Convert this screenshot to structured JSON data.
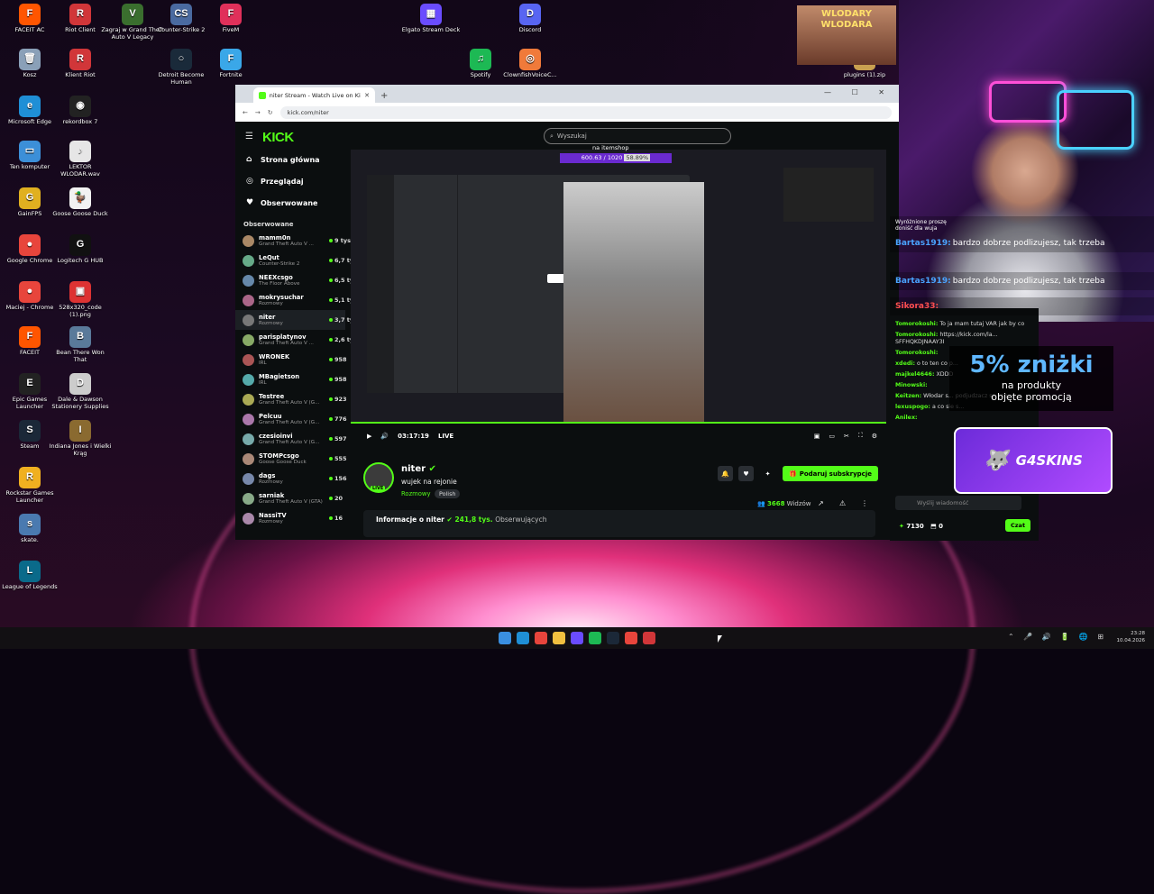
{
  "desktop_icons": [
    {
      "label": "FACEIT AC",
      "color": "#ff5500",
      "glyph": "F"
    },
    {
      "label": "Riot Client",
      "color": "#d13639",
      "glyph": "R"
    },
    {
      "label": "Zagraj w Grand Theft Auto V Legacy",
      "color": "#3a6e2e",
      "glyph": "V"
    },
    {
      "label": "Counter-Strike 2",
      "color": "#4a6aa0",
      "glyph": "CS"
    },
    {
      "label": "FiveM",
      "color": "#e0305a",
      "glyph": "F"
    },
    {
      "label": "Elgato Stream Deck",
      "color": "#6a4cff",
      "glyph": "▦"
    },
    {
      "label": "Discord",
      "color": "#5865f2",
      "glyph": "D"
    },
    {
      "label": "Kosz",
      "color": "#8aa0b8",
      "glyph": "🗑"
    },
    {
      "label": "Klient Riot",
      "color": "#d13639",
      "glyph": "R"
    },
    {
      "label": "Detroit Become Human",
      "color": "#1a2a3a",
      "glyph": "○"
    },
    {
      "label": "Fortnite",
      "color": "#3aa7e8",
      "glyph": "F"
    },
    {
      "label": "Spotify",
      "color": "#1db954",
      "glyph": "♫"
    },
    {
      "label": "ClownfishVoiceC...",
      "color": "#f07a3a",
      "glyph": "◎"
    },
    {
      "label": "plugins (1).zip",
      "color": "#c9a050",
      "glyph": "Z"
    },
    {
      "label": "Microsoft Edge",
      "color": "#1f8fd6",
      "glyph": "e"
    },
    {
      "label": "rekordbox 7",
      "color": "#222",
      "glyph": "◉"
    },
    {
      "label": "Ten komputer",
      "color": "#3c8fd8",
      "glyph": "▭"
    },
    {
      "label": "LEKTOR WLODAR.wav",
      "color": "#e6e6e6",
      "glyph": "♪"
    },
    {
      "label": "GainFPS",
      "color": "#e0b020",
      "glyph": "G"
    },
    {
      "label": "Goose Goose Duck",
      "color": "#f2f2f2",
      "glyph": "🦆"
    },
    {
      "label": "Google Chrome",
      "color": "#e8453c",
      "glyph": "●"
    },
    {
      "label": "Logitech G HUB",
      "color": "#111",
      "glyph": "G"
    },
    {
      "label": "Maciej - Chrome",
      "color": "#e8453c",
      "glyph": "●"
    },
    {
      "label": "528x320_code (1).png",
      "color": "#d33",
      "glyph": "▣"
    },
    {
      "label": "FACEIT",
      "color": "#ff5500",
      "glyph": "F"
    },
    {
      "label": "Bean There Won That",
      "color": "#5a7a9a",
      "glyph": "B"
    },
    {
      "label": "Epic Games Launcher",
      "color": "#222",
      "glyph": "E"
    },
    {
      "label": "Dale & Dawson Stationery Supplies",
      "color": "#ccc",
      "glyph": "D"
    },
    {
      "label": "Steam",
      "color": "#1b2838",
      "glyph": "S"
    },
    {
      "label": "Indiana Jones i Wielki Krąg",
      "color": "#8a6a30",
      "glyph": "I"
    },
    {
      "label": "Rockstar Games Launcher",
      "color": "#f0b020",
      "glyph": "R"
    },
    {
      "label": "skate.",
      "color": "#4a7ab0",
      "glyph": "s"
    },
    {
      "label": "League of Legends",
      "color": "#0a6a8a",
      "glyph": "L"
    }
  ],
  "browser": {
    "tab_title": "niter Stream - Watch Live on Kick",
    "url": "kick.com/niter"
  },
  "kick": {
    "logo": "KICK",
    "search_placeholder": "Wyszukaj",
    "nav": [
      "Strona główna",
      "Przeglądaj",
      "Obserwowane"
    ],
    "followed_header": "Obserwowane",
    "channels": [
      {
        "name": "mamm0n",
        "game": "Grand Theft Auto V ...",
        "viewers": "9 tys.",
        "color": "#a86"
      },
      {
        "name": "LeQut",
        "game": "Counter-Strike 2",
        "viewers": "6,7 tys.",
        "color": "#6a8"
      },
      {
        "name": "NEEXcsgo",
        "game": "The Floor Above",
        "viewers": "6,5 tys.",
        "color": "#68a"
      },
      {
        "name": "mokrysuchar",
        "game": "Rozmowy",
        "viewers": "5,1 tys.",
        "color": "#a68"
      },
      {
        "name": "niter",
        "game": "Rozmowy",
        "viewers": "3,7 tys.",
        "color": "#777"
      },
      {
        "name": "parisplatynov",
        "game": "Grand Theft Auto V ...",
        "viewers": "2,6 tys.",
        "color": "#8a6"
      },
      {
        "name": "WRONEK",
        "game": "IRL",
        "viewers": "958",
        "color": "#a55"
      },
      {
        "name": "MBagietson",
        "game": "IRL",
        "viewers": "958",
        "color": "#5aa"
      },
      {
        "name": "Testree",
        "game": "Grand Theft Auto V (G...",
        "viewers": "923",
        "color": "#aa5"
      },
      {
        "name": "Pelcuu",
        "game": "Grand Theft Auto V (G...",
        "viewers": "776",
        "color": "#a7a"
      },
      {
        "name": "czesioinvi",
        "game": "Grand Theft Auto V (G...",
        "viewers": "597",
        "color": "#7aa"
      },
      {
        "name": "STOMPcsgo",
        "game": "Goose Goose Duck",
        "viewers": "555",
        "color": "#a87"
      },
      {
        "name": "dags",
        "game": "Rozmowy",
        "viewers": "156",
        "color": "#78a"
      },
      {
        "name": "sarniak",
        "game": "Grand Theft Auto V (GTA)",
        "viewers": "20",
        "color": "#8a8"
      },
      {
        "name": "NassiTV",
        "game": "Rozmowy",
        "viewers": "16",
        "color": "#a8a"
      }
    ],
    "player": {
      "time": "03:17:19",
      "live": "LIVE",
      "goal_label": "na itemshop",
      "goal_value": "600.63 / 1020",
      "goal_percent": "58.89%",
      "progress_fraction": 1.0
    },
    "channel": {
      "name": "niter",
      "title": "wujek na rejonie",
      "category": "Rozmowy",
      "tag": "Polish",
      "subscribe": "Podaruj subskrypcje",
      "viewers_count": "3668",
      "viewers_label": "Widzów",
      "live_badge": "LIVE"
    },
    "about": {
      "label": "Informacje o niter",
      "followers": "241,8 tys.",
      "followers_label": "Obserwujących"
    }
  },
  "chat": {
    "messages": [
      {
        "user": "Tomorokoshi:",
        "text": "To ja mam tutaj VAR jak by co"
      },
      {
        "user": "Tomorokoshi:",
        "text": "https://kick.com/la... SFFHQKDJNAAY3I"
      },
      {
        "user": "Tomorokoshi:",
        "text": ""
      },
      {
        "user": "xdedi:",
        "text": "o to ten co p..."
      },
      {
        "user": "majkel4646:",
        "text": "XDDD"
      },
      {
        "user": "Minowski:",
        "text": ""
      },
      {
        "user": "Keitzen:",
        "text": "Włodar s... podjudzacz sp zoo"
      },
      {
        "user": "lexuspogo:",
        "text": "a co sie s..."
      },
      {
        "user": "Anilex:",
        "text": ""
      }
    ],
    "input_placeholder": "Wyślij wiadomość",
    "points": "7130",
    "count": "0",
    "send": "Czat"
  },
  "overlay": {
    "top_banner": "WLODARY WLODARA",
    "lines": [
      {
        "user": "Wyróżnione proszę",
        "text": "doniść dla wuja"
      },
      {
        "user": "Bartas1919:",
        "text": "bardzo dobrze podlizujesz, tak trzeba"
      },
      {
        "user": "Bartas1919:",
        "text": "bardzo dobrze podlizujesz, tak trzeba"
      },
      {
        "user": "Sikora33:",
        "text": ""
      }
    ],
    "promo_big": "5% zniżki",
    "promo_line1": "na produkty",
    "promo_line2": "objęte promocją",
    "sponsor": "G4SKINS"
  },
  "taskbar": {
    "time": "23:28",
    "date": "10.04.2026",
    "apps": [
      "#1f8fd6",
      "#e8453c",
      "#f0c040",
      "#6a4cff",
      "#1db954",
      "#1b2838",
      "#e8453c",
      "#d13639"
    ]
  }
}
